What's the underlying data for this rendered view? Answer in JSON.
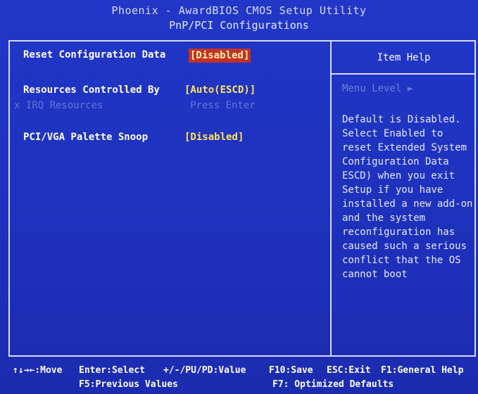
{
  "header": {
    "title": "Phoenix - AwardBIOS CMOS Setup Utility",
    "subtitle": "PnP/PCI Configurations"
  },
  "settings": [
    {
      "label": "Reset Configuration Data",
      "value": "[Disabled]"
    },
    {
      "label": "Resources Controlled By",
      "value": "[Auto(ESCD)]"
    },
    {
      "label": "x IRQ Resources",
      "value": "Press Enter"
    },
    {
      "label": "PCI/VGA Palette Snoop",
      "value": "[Disabled]"
    }
  ],
  "help": {
    "title": "Item Help",
    "menu_level": "Menu Level   ►",
    "text": "Default is Disabled.\nSelect Enabled to\nreset Extended System\nConfiguration Data\nESCD) when you exit\nSetup if you have\ninstalled a new add-on\nand the system\nreconfiguration has\ncaused such a serious\nconflict that the OS\ncannot boot"
  },
  "footer": {
    "move": "↑↓→←:Move",
    "select": "Enter:Select",
    "value": "+/-/PU/PD:Value",
    "save": "F10:Save",
    "exit": "ESC:Exit",
    "help": "F1:General Help",
    "previous": "F5:Previous Values",
    "optimized": "F7: Optimized Defaults"
  },
  "colors": {
    "background": "#1f33c0",
    "label": "#ffffff",
    "value": "#ffe25a",
    "highlight": "#c53024",
    "disabled": "#5f74d8"
  }
}
